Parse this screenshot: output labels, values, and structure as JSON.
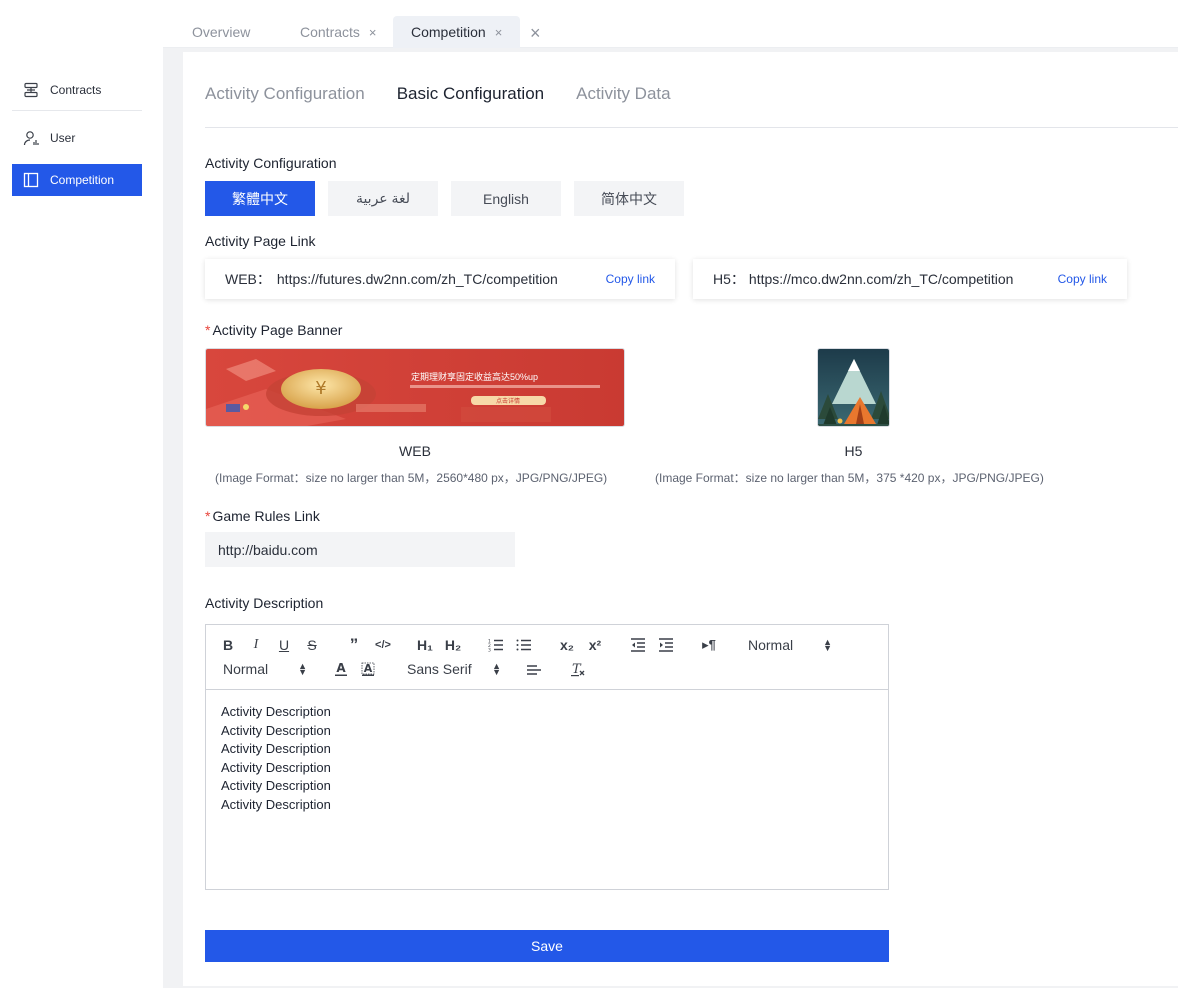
{
  "sidebar": {
    "items": [
      {
        "label": "Contracts",
        "icon": "server-icon",
        "active": false
      },
      {
        "label": "User",
        "icon": "user-chart-icon",
        "active": false
      },
      {
        "label": "Competition",
        "icon": "layout-icon",
        "active": true
      }
    ]
  },
  "tabs": [
    {
      "label": "Overview",
      "closable": false,
      "active": false
    },
    {
      "label": "Contracts",
      "closable": true,
      "active": false
    },
    {
      "label": "Competition",
      "closable": true,
      "active": true
    }
  ],
  "subtabs": [
    "Activity Configuration",
    "Basic Configuration",
    "Activity Data"
  ],
  "activity_config": {
    "label": "Activity Configuration",
    "languages": [
      "繁體中文",
      "لغة عربية",
      "English",
      "简体中文"
    ]
  },
  "page_link": {
    "label": "Activity Page Link",
    "web": {
      "prefix": "WEB：",
      "url": "https://futures.dw2nn.com/zh_TC/competition",
      "copy": "Copy link"
    },
    "h5": {
      "prefix": "H5：",
      "url": "https://mco.dw2nn.com/zh_TC/competition",
      "copy": "Copy link"
    }
  },
  "banner": {
    "label": "Activity Page Banner",
    "web_caption": "WEB",
    "web_hint": "(Image Format：size no larger than 5M，2560*480 px，JPG/PNG/JPEG)",
    "h5_caption": "H5",
    "h5_hint": "(Image Format：size no larger than 5M，375 *420 px，JPG/PNG/JPEG)",
    "web_banner_text": "定期理财享固定收益高达50%up",
    "web_banner_button": "点击详情"
  },
  "rules": {
    "label": "Game Rules Link",
    "value": "http://baidu.com"
  },
  "description": {
    "label": "Activity Description",
    "toolbar": {
      "header_select": "Normal",
      "size_select": "Normal",
      "font_select": "Sans Serif",
      "h1": "H₁",
      "h2": "H₂",
      "sub": "x₂",
      "sup": "x²",
      "rtl": "▸¶"
    },
    "lines": [
      "Activity Description",
      "Activity Description",
      "Activity Description",
      "Activity Description",
      "Activity Description",
      "Activity Description"
    ]
  },
  "save_label": "Save",
  "colors": {
    "accent": "#2358e8",
    "required": "#e8453c"
  }
}
